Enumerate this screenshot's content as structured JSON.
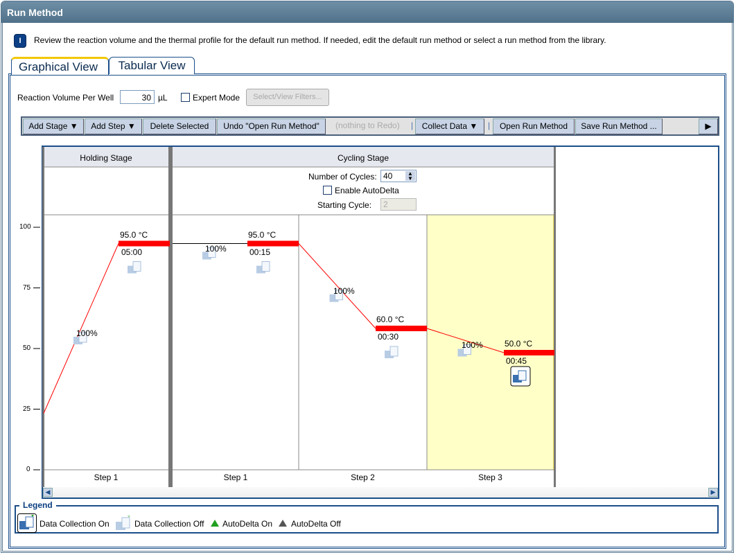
{
  "window": {
    "title": "Run Method"
  },
  "info": {
    "text": "Review the reaction volume and the thermal profile for the default run method. If needed, edit the default run method or select a run method from the library.",
    "icon": "info-icon"
  },
  "tabs": [
    {
      "label": "Graphical View",
      "active": true
    },
    {
      "label": "Tabular View",
      "active": false
    }
  ],
  "settings": {
    "volume_label": "Reaction Volume Per Well",
    "volume_value": "30",
    "volume_unit": "µL",
    "expert_mode_label": "Expert Mode",
    "expert_mode_checked": false,
    "filters_label": "Select/View Filters..."
  },
  "toolbar": {
    "add_stage": "Add Stage ▼",
    "add_step": "Add Step ▼",
    "delete_selected": "Delete Selected",
    "undo": "Undo \"Open Run Method\"",
    "redo": "(nothing to Redo)",
    "collect_data": "Collect Data ▼",
    "open_run_method": "Open Run Method",
    "save_run_method": "Save Run Method ...",
    "more": "▶"
  },
  "chart": {
    "y_ticks": [
      "100",
      "75",
      "50",
      "25",
      "0"
    ],
    "y_tick_values": [
      100,
      75,
      50,
      25,
      0
    ],
    "start_temp": 25,
    "holding": {
      "title": "Holding Stage",
      "steps": [
        {
          "label": "Step 1",
          "temp": "95.0 °C",
          "temp_value": 95,
          "time": "05:00",
          "ramp": "100%",
          "collect": false
        }
      ]
    },
    "cycling": {
      "title": "Cycling Stage",
      "cycles_label": "Number of Cycles:",
      "cycles_value": "40",
      "autodelta_label": "Enable AutoDelta",
      "autodelta_checked": false,
      "starting_cycle_label": "Starting Cycle:",
      "starting_cycle_value": "2",
      "steps": [
        {
          "label": "Step 1",
          "temp": "95.0 °C",
          "temp_value": 95,
          "time": "00:15",
          "ramp": "100%",
          "collect": false
        },
        {
          "label": "Step 2",
          "temp": "60.0 °C",
          "temp_value": 60,
          "time": "00:30",
          "ramp": "100%",
          "collect": false
        },
        {
          "label": "Step 3",
          "temp": "50.0 °C",
          "temp_value": 50,
          "time": "00:45",
          "ramp": "100%",
          "collect": true,
          "selected": true
        }
      ]
    },
    "colors": {
      "profile": "#ff0000",
      "selected_step": "#ffffc8",
      "header": "#e6e8f0"
    }
  },
  "legend": {
    "title": "Legend",
    "items": [
      "Data Collection On",
      "Data Collection Off",
      "AutoDelta On",
      "AutoDelta Off"
    ],
    "colors": {
      "autodelta_on": "#20a020",
      "autodelta_off": "#555555"
    }
  }
}
